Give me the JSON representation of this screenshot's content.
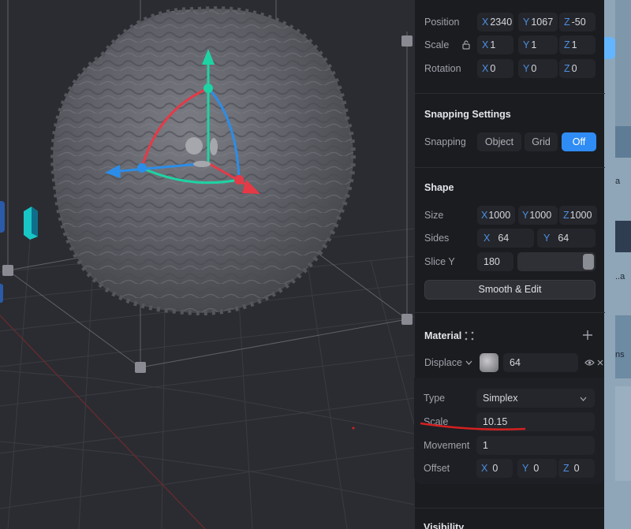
{
  "transform": {
    "position": {
      "label": "Position",
      "x": "2340",
      "y": "1067",
      "z": "-50"
    },
    "scale": {
      "label": "Scale",
      "x": "1",
      "y": "1",
      "z": "1"
    },
    "rotation": {
      "label": "Rotation",
      "x": "0",
      "y": "0",
      "z": "0"
    },
    "axes": {
      "x": "X",
      "y": "Y",
      "z": "Z"
    }
  },
  "snapping": {
    "title": "Snapping Settings",
    "label": "Snapping",
    "options": [
      "Object",
      "Grid",
      "Off"
    ],
    "selected": "Off"
  },
  "shape": {
    "title": "Shape",
    "size": {
      "label": "Size",
      "x": "1000",
      "y": "1000",
      "z": "1000"
    },
    "sides": {
      "label": "Sides",
      "x": "64",
      "y": "64"
    },
    "slice_y": {
      "label": "Slice Y",
      "value": "180"
    },
    "smooth_edit_label": "Smooth & Edit"
  },
  "material": {
    "title": "Material",
    "displace": {
      "label": "Displace",
      "value": "64"
    },
    "type": {
      "label": "Type",
      "value": "Simplex"
    },
    "scale": {
      "label": "Scale",
      "value": "10.15"
    },
    "movement": {
      "label": "Movement",
      "value": "1"
    },
    "offset": {
      "label": "Offset",
      "x": "0",
      "y": "0",
      "z": "0"
    }
  },
  "visibility": {
    "title": "Visibility"
  },
  "side_strip": {
    "texts": [
      "a",
      "..a",
      "ns"
    ]
  },
  "colors": {
    "accent": "#2f8cf5",
    "axis_label": "#4a90e2",
    "gizmo_x": "#e53946",
    "gizmo_y": "#1ed3a3",
    "gizmo_z": "#2b8de8",
    "annotation": "#d42020"
  },
  "icons": [
    "lock-icon",
    "plus-icon",
    "grid-dots-icon",
    "eye-icon",
    "close-icon",
    "chevron-down-icon"
  ]
}
